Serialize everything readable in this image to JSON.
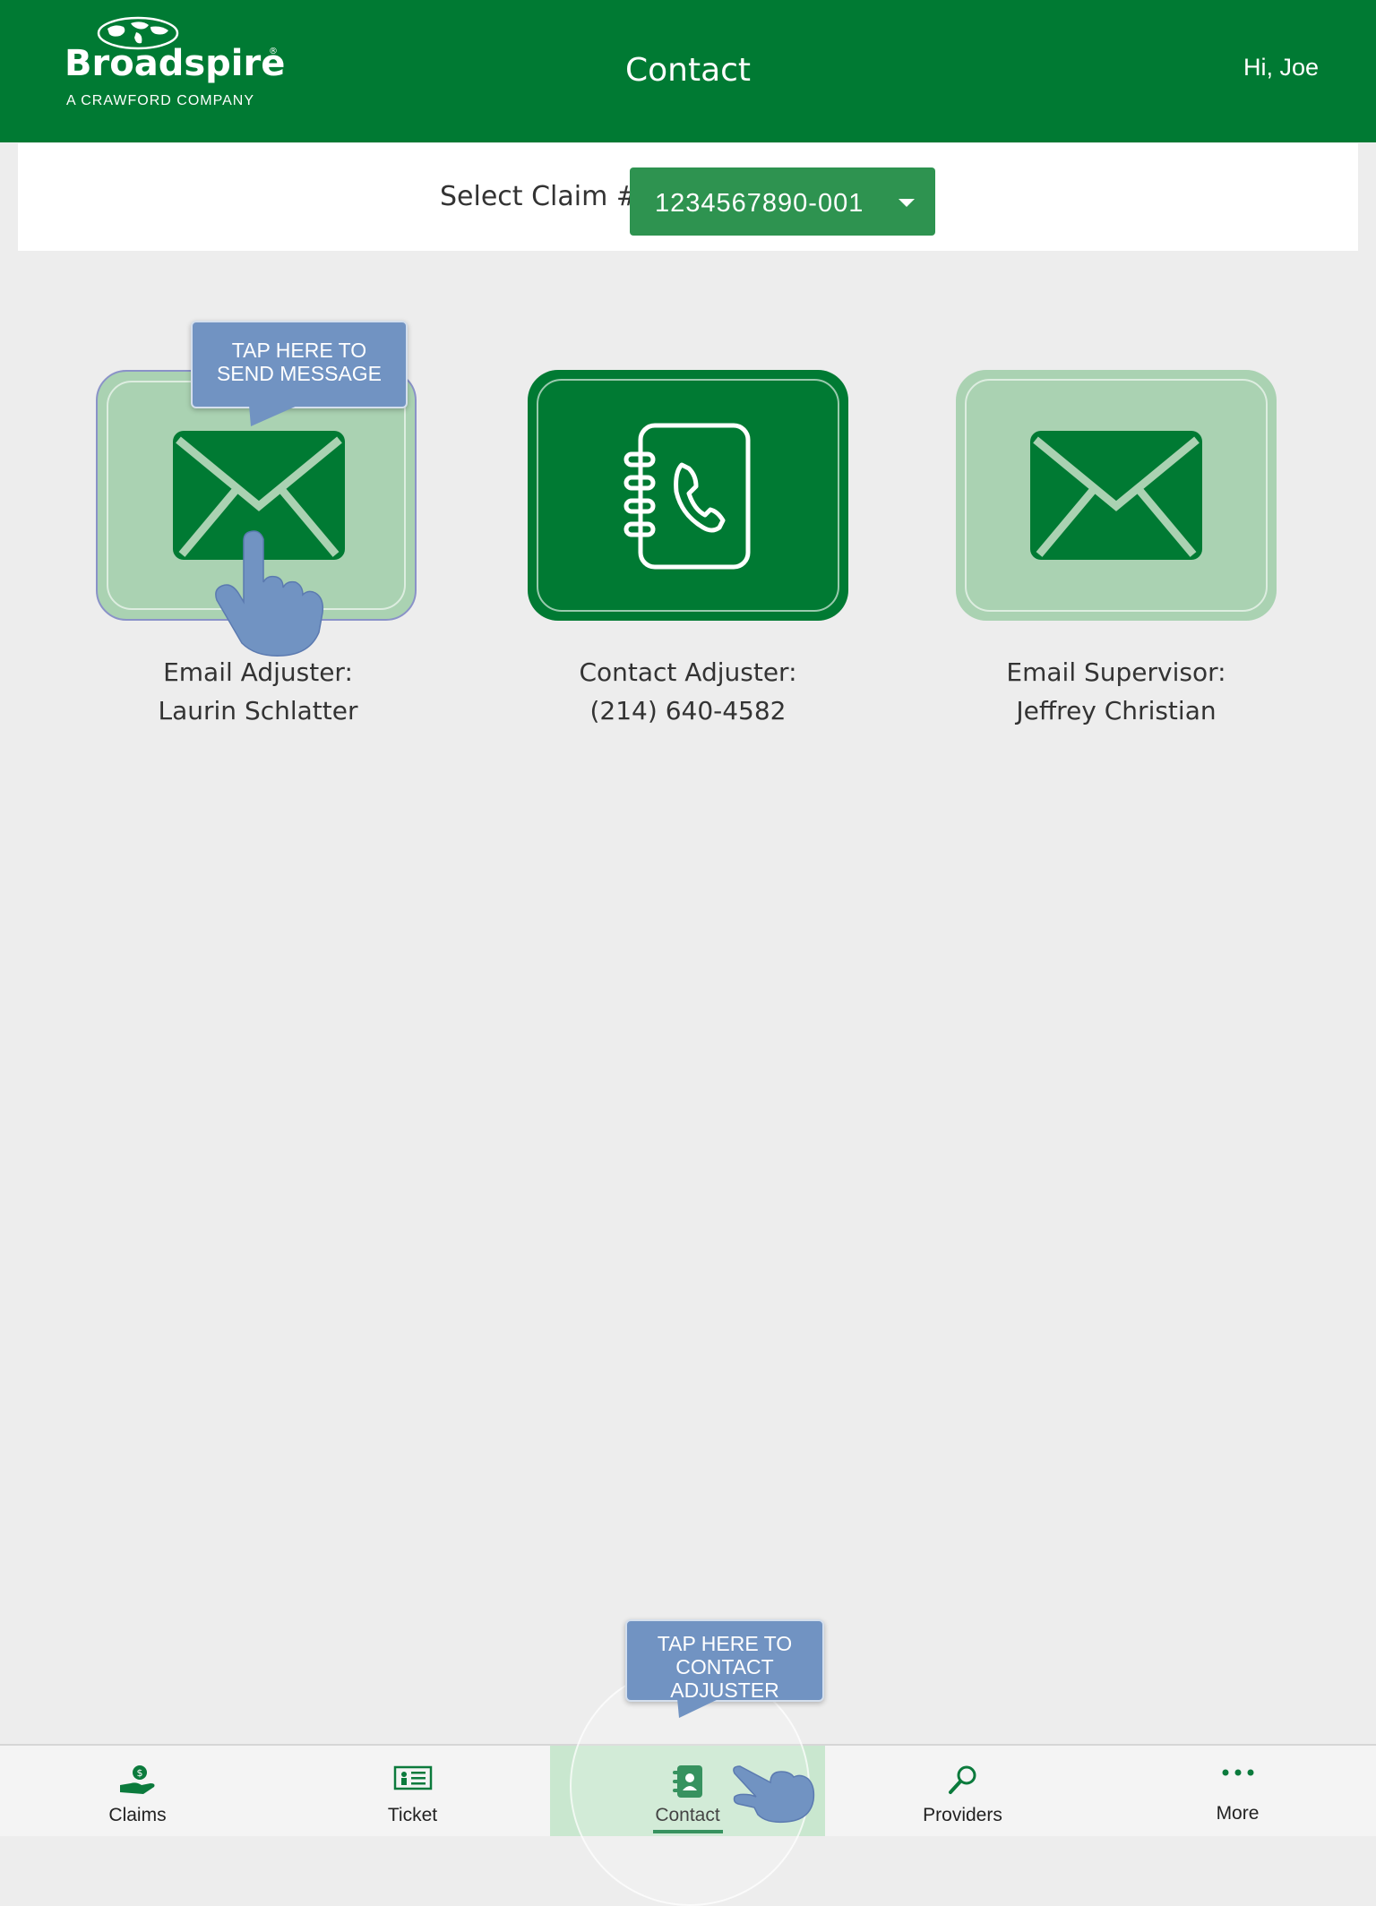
{
  "header": {
    "logo_text": "Broadspire",
    "logo_subtitle": "A CRAWFORD COMPANY",
    "title": "Contact",
    "greeting": "Hi, Joe"
  },
  "claim": {
    "label": "Select Claim #",
    "selected": "1234567890-001"
  },
  "actions": [
    {
      "title": "Email Adjuster:",
      "value": "Laurin Schlatter",
      "icon": "envelope-icon"
    },
    {
      "title": "Contact Adjuster:",
      "value": "(214) 640-4582",
      "icon": "address-book-phone-icon"
    },
    {
      "title": "Email Supervisor:",
      "value": "Jeffrey Christian",
      "icon": "envelope-icon"
    }
  ],
  "tooltips": {
    "send_message_line1": "TAP HERE TO",
    "send_message_line2": "SEND MESSAGE",
    "contact_adjuster_line1": "TAP HERE TO",
    "contact_adjuster_line2": "CONTACT ADJUSTER"
  },
  "nav": {
    "items": [
      {
        "label": "Claims",
        "icon": "money-hand-icon"
      },
      {
        "label": "Ticket",
        "icon": "ticket-icon"
      },
      {
        "label": "Contact",
        "icon": "contact-book-icon",
        "active": true
      },
      {
        "label": "Providers",
        "icon": "search-icon"
      },
      {
        "label": "More",
        "icon": "more-dots-icon"
      }
    ]
  },
  "colors": {
    "brand_green": "#007a33",
    "tile_light": "#aad2b2",
    "tooltip_blue": "#7193c2",
    "background": "#ededed"
  }
}
